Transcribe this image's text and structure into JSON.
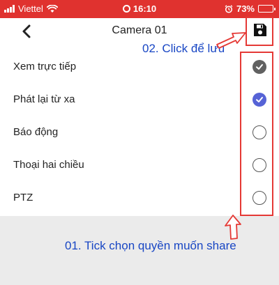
{
  "status_bar": {
    "carrier": "Viettel",
    "time": "16:10",
    "battery": "73%"
  },
  "nav": {
    "title": "Camera 01"
  },
  "permissions": [
    {
      "label": "Xem trực tiếp",
      "checked": true,
      "check_color": "#616161"
    },
    {
      "label": "Phát lại từ xa",
      "checked": true,
      "check_color": "#5663d6"
    },
    {
      "label": "Báo động",
      "checked": false
    },
    {
      "label": "Thoại hai chiều",
      "checked": false
    },
    {
      "label": "PTZ",
      "checked": false
    }
  ],
  "annotations": {
    "save_hint": "02. Click để lưu",
    "tick_hint": "01. Tick chọn quyền muốn share",
    "color": "#1846c4",
    "highlight_color": "#e53935"
  },
  "colors": {
    "status_bar": "#e0322f",
    "accent": "#5663d6"
  }
}
